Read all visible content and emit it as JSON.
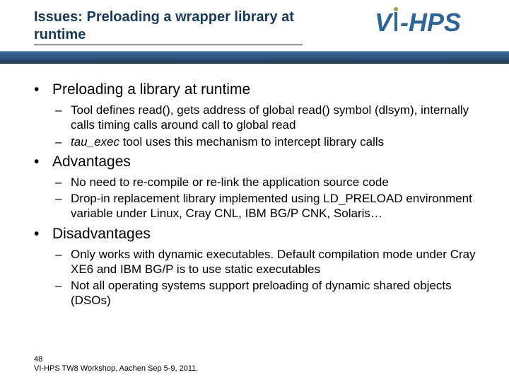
{
  "header": {
    "title": "Issues: Preloading a wrapper library at runtime",
    "logo_text_prefix": "V",
    "logo_text_suffix": "-HPS"
  },
  "bullets": [
    {
      "text": "Preloading a library at runtime",
      "sub": [
        {
          "text": "Tool defines read(), gets address of global read() symbol (dlsym), internally calls timing calls around call to global read"
        },
        {
          "prefix_italic": "tau_exec",
          "rest": " tool uses this mechanism to intercept library calls"
        }
      ]
    },
    {
      "text": "Advantages",
      "sub": [
        {
          "text": "No need to re-compile or re-link the application source code"
        },
        {
          "text": "Drop-in replacement library implemented using LD_PRELOAD environment variable under Linux, Cray CNL, IBM BG/P CNK, Solaris…"
        }
      ]
    },
    {
      "text": "Disadvantages",
      "sub": [
        {
          "text": "Only works with dynamic executables. Default compilation mode under Cray XE6 and IBM BG/P is to use static executables"
        },
        {
          "text": "Not all operating systems support preloading of dynamic shared objects (DSOs)"
        }
      ]
    }
  ],
  "footer": {
    "page": "48",
    "line": "VI-HPS TW8 Workshop, Aachen Sep 5-9, 2011."
  }
}
